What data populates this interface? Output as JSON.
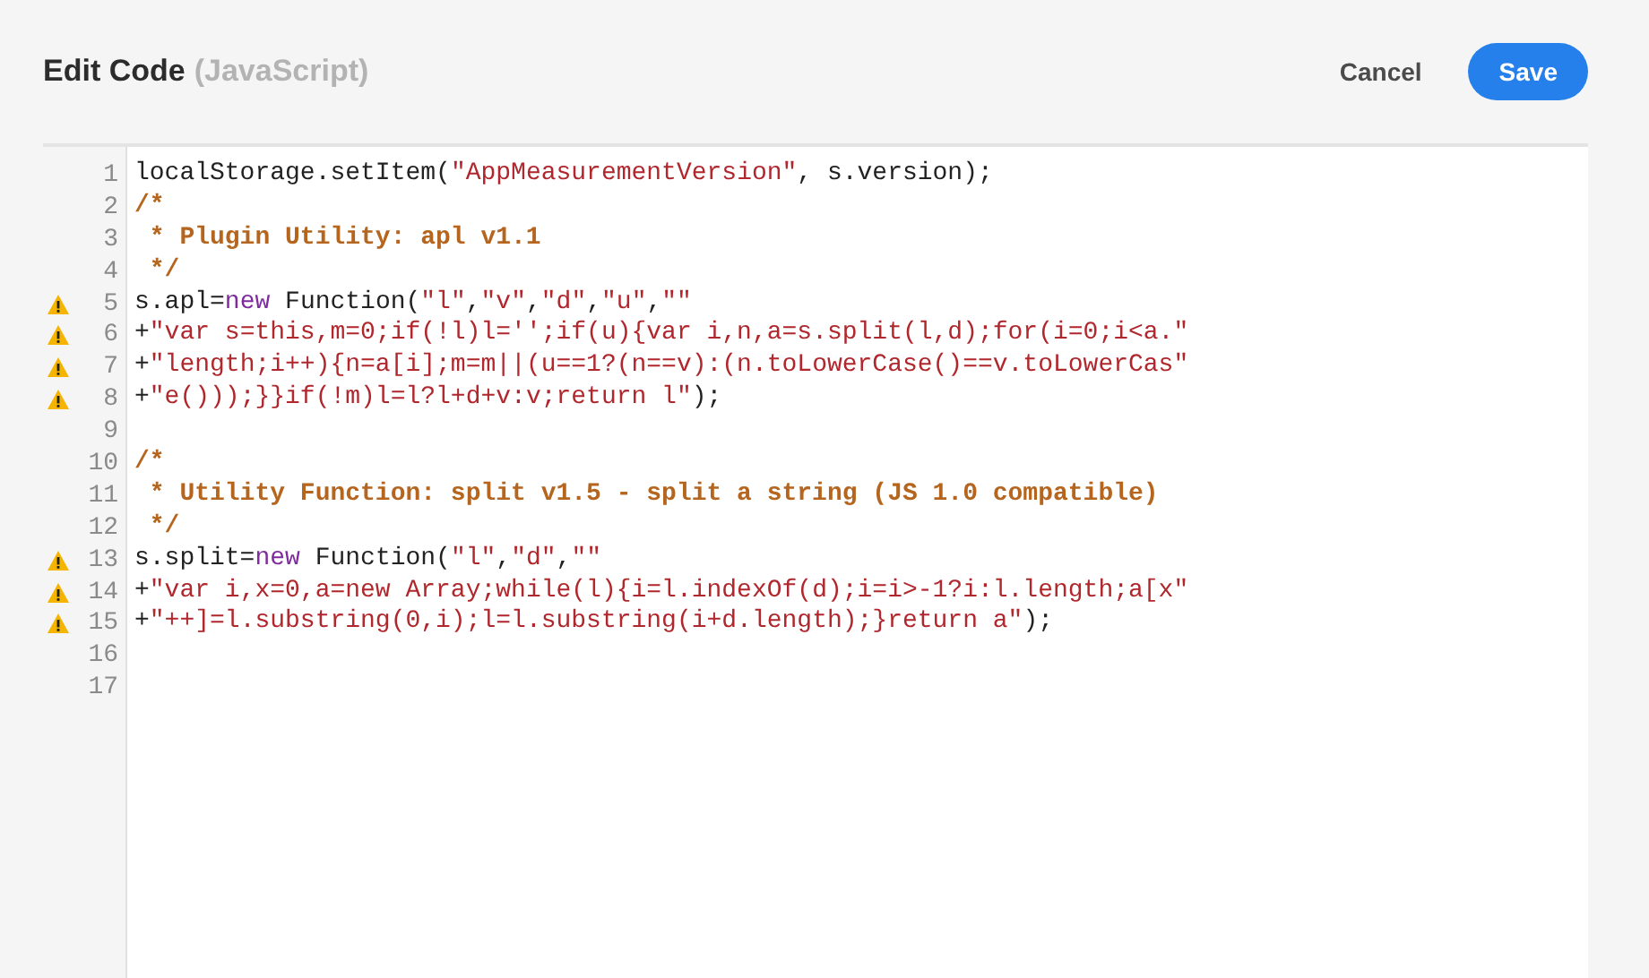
{
  "header": {
    "title": "Edit Code",
    "subtitle": "(JavaScript)",
    "cancel": "Cancel",
    "save": "Save"
  },
  "lines": [
    {
      "number": "1",
      "warning": false,
      "tokens": [
        {
          "kind": "plain",
          "text": "localStorage.setItem("
        },
        {
          "kind": "string",
          "text": "\"AppMeasurementVersion\""
        },
        {
          "kind": "plain",
          "text": ", s.version);"
        }
      ]
    },
    {
      "number": "2",
      "warning": false,
      "tokens": [
        {
          "kind": "comment",
          "text": "/*"
        }
      ]
    },
    {
      "number": "3",
      "warning": false,
      "tokens": [
        {
          "kind": "comment",
          "text": " * Plugin Utility: apl v1.1"
        }
      ]
    },
    {
      "number": "4",
      "warning": false,
      "tokens": [
        {
          "kind": "comment",
          "text": " */"
        }
      ]
    },
    {
      "number": "5",
      "warning": true,
      "tokens": [
        {
          "kind": "plain",
          "text": "s.apl="
        },
        {
          "kind": "keyword",
          "text": "new"
        },
        {
          "kind": "plain",
          "text": " Function("
        },
        {
          "kind": "string",
          "text": "\"l\""
        },
        {
          "kind": "plain",
          "text": ","
        },
        {
          "kind": "string",
          "text": "\"v\""
        },
        {
          "kind": "plain",
          "text": ","
        },
        {
          "kind": "string",
          "text": "\"d\""
        },
        {
          "kind": "plain",
          "text": ","
        },
        {
          "kind": "string",
          "text": "\"u\""
        },
        {
          "kind": "plain",
          "text": ","
        },
        {
          "kind": "string",
          "text": "\"\""
        }
      ]
    },
    {
      "number": "6",
      "warning": true,
      "tokens": [
        {
          "kind": "plain",
          "text": "+"
        },
        {
          "kind": "string",
          "text": "\"var s=this,m=0;if(!l)l='';if(u){var i,n,a=s.split(l,d);for(i=0;i<a.\""
        }
      ]
    },
    {
      "number": "7",
      "warning": true,
      "tokens": [
        {
          "kind": "plain",
          "text": "+"
        },
        {
          "kind": "string",
          "text": "\"length;i++){n=a[i];m=m||(u==1?(n==v):(n.toLowerCase()==v.toLowerCas\""
        }
      ]
    },
    {
      "number": "8",
      "warning": true,
      "tokens": [
        {
          "kind": "plain",
          "text": "+"
        },
        {
          "kind": "string",
          "text": "\"e()));}}if(!m)l=l?l+d+v:v;return l\""
        },
        {
          "kind": "plain",
          "text": ");"
        }
      ]
    },
    {
      "number": "9",
      "warning": false
    },
    {
      "number": "10",
      "warning": false,
      "tokens": [
        {
          "kind": "comment",
          "text": "/*"
        }
      ]
    },
    {
      "number": "11",
      "warning": false,
      "tokens": [
        {
          "kind": "comment",
          "text": " * Utility Function: split v1.5 - split a string (JS 1.0 compatible)"
        }
      ]
    },
    {
      "number": "12",
      "warning": false,
      "tokens": [
        {
          "kind": "comment",
          "text": " */"
        }
      ]
    },
    {
      "number": "13",
      "warning": true,
      "tokens": [
        {
          "kind": "plain",
          "text": "s.split="
        },
        {
          "kind": "keyword",
          "text": "new"
        },
        {
          "kind": "plain",
          "text": " Function("
        },
        {
          "kind": "string",
          "text": "\"l\""
        },
        {
          "kind": "plain",
          "text": ","
        },
        {
          "kind": "string",
          "text": "\"d\""
        },
        {
          "kind": "plain",
          "text": ","
        },
        {
          "kind": "string",
          "text": "\"\""
        }
      ]
    },
    {
      "number": "14",
      "warning": true,
      "tokens": [
        {
          "kind": "plain",
          "text": "+"
        },
        {
          "kind": "string",
          "text": "\"var i,x=0,a=new Array;while(l){i=l.indexOf(d);i=i>-1?i:l.length;a[x\""
        }
      ]
    },
    {
      "number": "15",
      "warning": true,
      "tokens": [
        {
          "kind": "plain",
          "text": "+"
        },
        {
          "kind": "string",
          "text": "\"++]=l.substring(0,i);l=l.substring(i+d.length);}return a\""
        },
        {
          "kind": "plain",
          "text": ");"
        }
      ]
    },
    {
      "number": "16",
      "warning": false
    },
    {
      "number": "17",
      "warning": false
    }
  ]
}
